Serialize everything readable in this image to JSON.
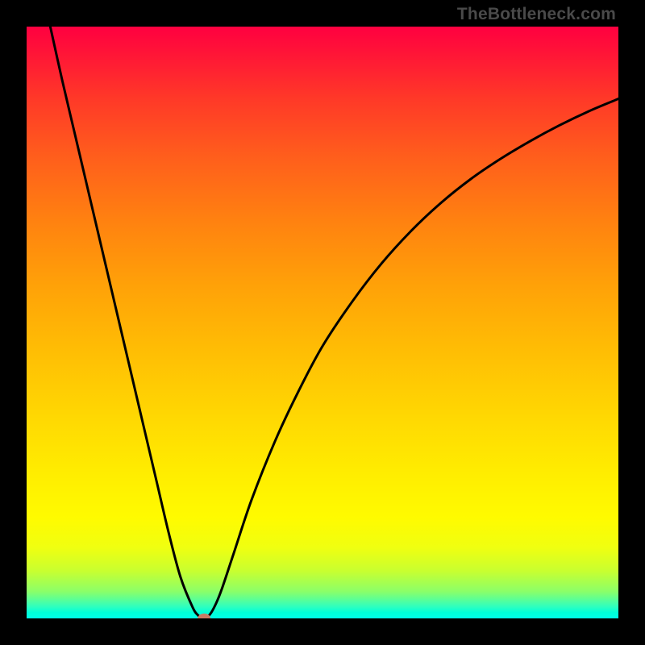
{
  "watermark": "TheBottleneck.com",
  "colors": {
    "curve": "#000000",
    "minpoint": "#c97a64",
    "frame": "#000000"
  },
  "chart_data": {
    "type": "line",
    "title": "",
    "xlabel": "",
    "ylabel": "",
    "xlim": [
      0,
      100
    ],
    "ylim": [
      0,
      100
    ],
    "grid": false,
    "legend": false,
    "series": [
      {
        "name": "bottleneck-curve",
        "x": [
          4,
          6,
          8,
          10,
          12,
          14,
          16,
          18,
          20,
          22,
          24,
          26,
          28,
          29,
          30,
          31,
          32,
          33,
          35,
          38,
          42,
          46,
          50,
          55,
          60,
          65,
          70,
          75,
          80,
          85,
          90,
          95,
          100
        ],
        "y": [
          100,
          91,
          82.5,
          74,
          65.5,
          57,
          48.5,
          40,
          31.5,
          23,
          14.5,
          7,
          2,
          0.5,
          0,
          0.7,
          2.5,
          5,
          11,
          20,
          30,
          38.5,
          46,
          53.5,
          60,
          65.5,
          70.2,
          74.2,
          77.6,
          80.6,
          83.3,
          85.7,
          87.8
        ]
      }
    ],
    "annotations": [
      {
        "type": "point",
        "x": 30,
        "y": 0,
        "style": "minpoint"
      }
    ],
    "background": {
      "type": "vertical-gradient",
      "meaning": "green(low y)=good, red(high y)=bad",
      "stops": [
        {
          "pos": 0.0,
          "color": "#ff0040"
        },
        {
          "pos": 0.5,
          "color": "#ffc000"
        },
        {
          "pos": 0.85,
          "color": "#ffff00"
        },
        {
          "pos": 1.0,
          "color": "#00ffe0"
        }
      ]
    }
  }
}
